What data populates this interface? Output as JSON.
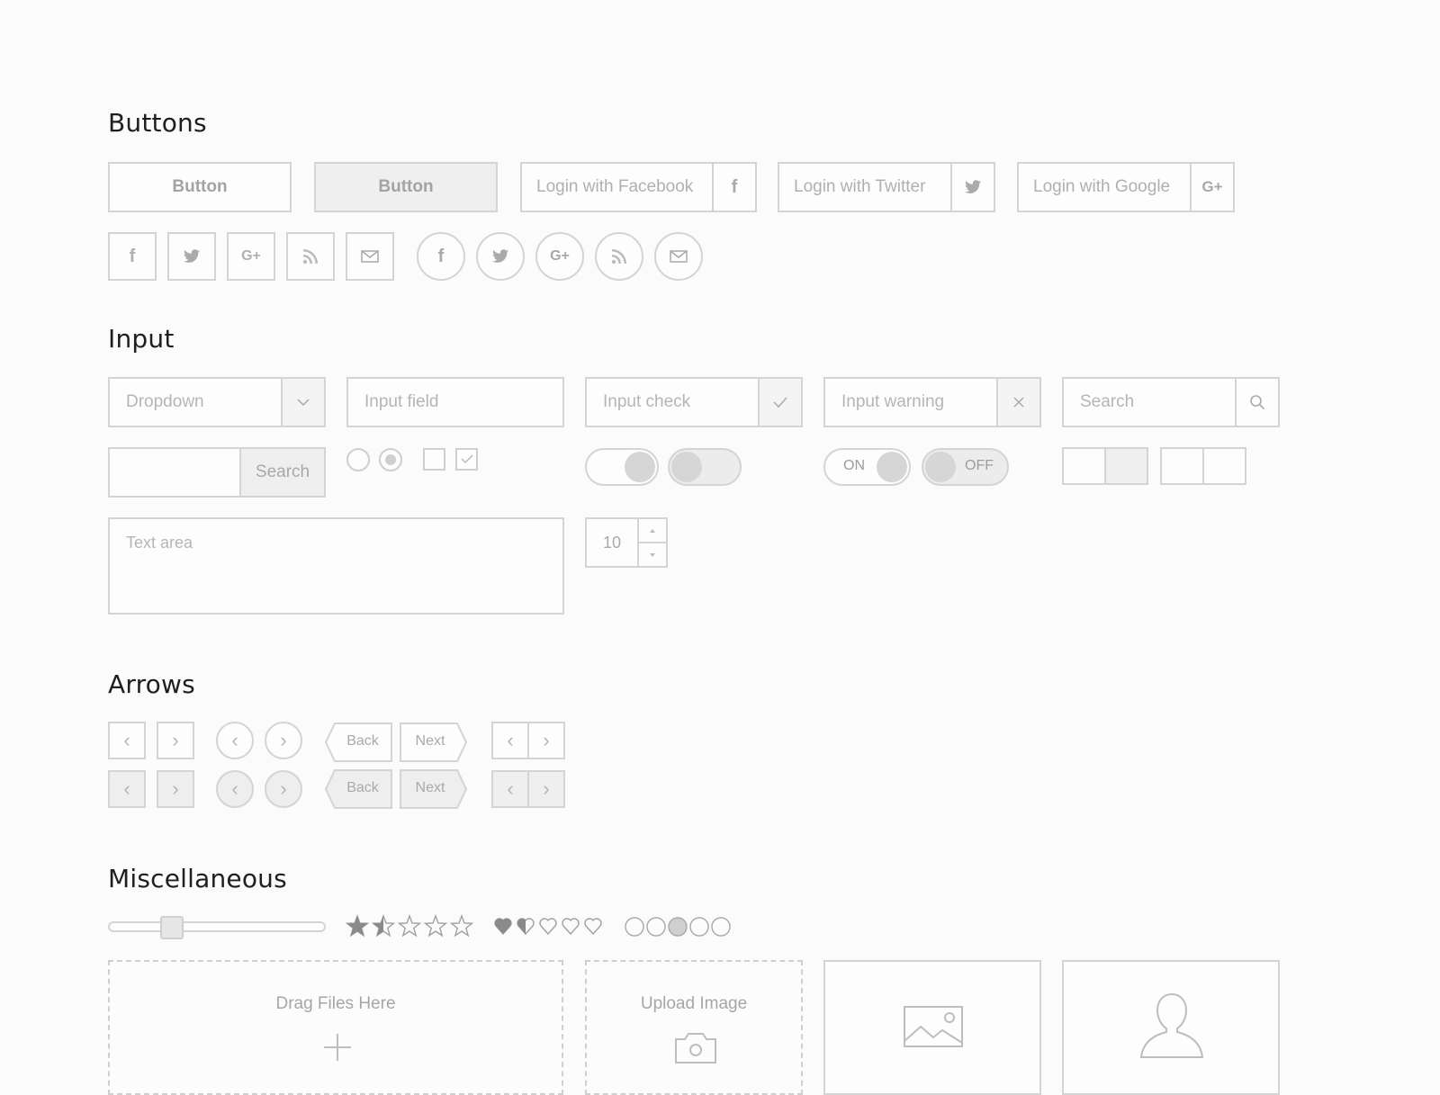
{
  "sections": {
    "buttons": "Buttons",
    "input": "Input",
    "arrows": "Arrows",
    "misc": "Miscellaneous"
  },
  "buttons": {
    "plain": "Button",
    "pressed": "Button",
    "facebook": "Login with Facebook",
    "twitter": "Login with Twitter",
    "google": "Login with Google",
    "fb_icon": "f",
    "gplus_icon": "G+"
  },
  "inputs": {
    "dropdown": "Dropdown",
    "field": "Input field",
    "check": "Input check",
    "warning": "Input warning",
    "search": "Search",
    "search_button": "Search",
    "textarea": "Text area",
    "stepper_value": "10",
    "toggle_on": "ON",
    "toggle_off": "OFF"
  },
  "arrows": {
    "back": "Back",
    "next": "Next"
  },
  "misc": {
    "slider_value": 0.27,
    "rating_stars": 1.5,
    "rating_hearts": 1.5,
    "page_active": 3,
    "drag_files": "Drag Files Here",
    "upload_image": "Upload Image"
  },
  "colors": {
    "border": "#d4d4d4",
    "fill_gray": "#efefef",
    "text_gray": "#a9a9a9"
  }
}
